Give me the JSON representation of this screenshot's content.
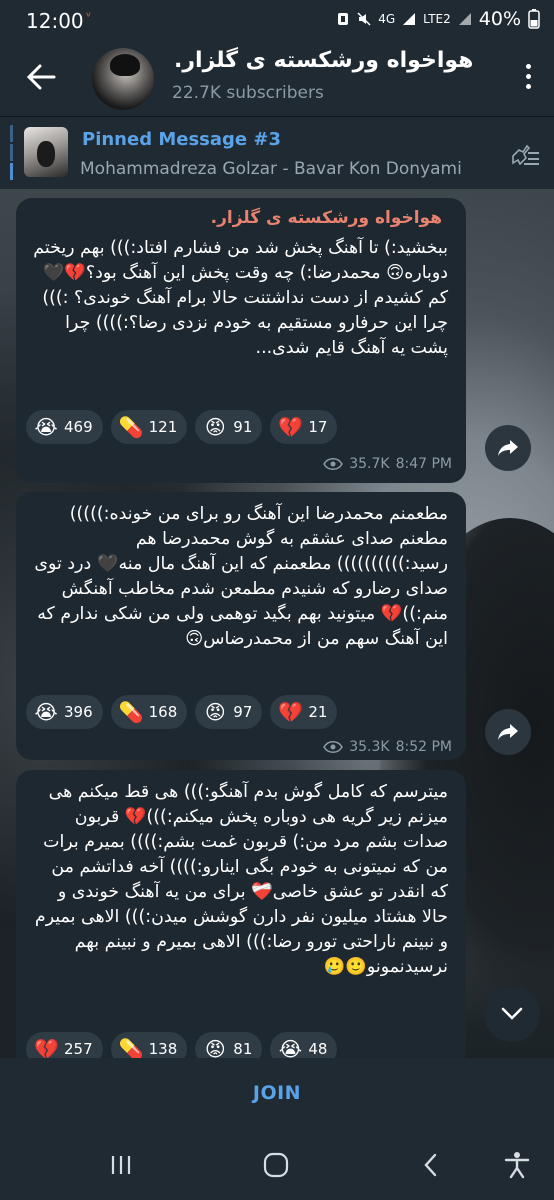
{
  "status": {
    "time": "12:00",
    "net": "4G",
    "lte": "LTE2",
    "battery": "40%"
  },
  "header": {
    "title": "هواخواه ورشکسته ی گلزار.",
    "subscribers": "22.7K subscribers"
  },
  "pinned": {
    "title": "Pinned Message #3",
    "text": "Mohammadreza Golzar - Bavar Kon Donyami"
  },
  "messages": [
    {
      "author": "هواخواه ورشکسته ی گلزار.",
      "text": "ببخشید:) تا آهنگ پخش شد من فشارم افتاد:))) بهم ریختم دوباره🙃 محمدرضا:) چه وقت پخش این آهنگ بود؟💔🖤 کم کشیدم از دست نداشتنت حالا برام آهنگ خوندی؟ :))) چرا این حرفارو مستقیم به خودم نزدی رضا؟:)))) چرا پشت یه آهنگ قایم شدی...",
      "reactions": [
        {
          "emoji": "😭",
          "count": "469"
        },
        {
          "emoji": "💊",
          "count": "121"
        },
        {
          "emoji": "😡",
          "count": "91"
        },
        {
          "emoji": "💔",
          "count": "17"
        }
      ],
      "views": "35.7K",
      "time": "8:47 PM"
    },
    {
      "author": "",
      "text": "مطعمنم محمدرضا این آهنگ رو برای من خونده:))))) مطعنم صدای عشقم به گوش محمدرضا هم رسید:)))))))))) مطعمنم که این آهنگ مال منه🖤 درد توی صدای رضارو که شنیدم مطمعن شدم مخاطب آهنگش منم:))💔 میتونید بهم بگید توهمی ولی من شکی ندارم که این آهنگ سهم من از محمدرضاس🙃",
      "reactions": [
        {
          "emoji": "😭",
          "count": "396"
        },
        {
          "emoji": "💊",
          "count": "168"
        },
        {
          "emoji": "😡",
          "count": "97"
        },
        {
          "emoji": "💔",
          "count": "21"
        }
      ],
      "views": "35.3K",
      "time": "8:52 PM"
    },
    {
      "author": "",
      "text": "میترسم که کامل گوش بدم آهنگو:))) هی قط میکنم هی میزنم زیر گریه هی دوباره پخش میکنم:)))💔 قربون صدات بشم مرد من:) قربون غمت بشم:)))) بمیرم برات من که نمیتونی به خودم بگی اینارو:)))) آخه فداتشم من که انقدر تو عشق خاصی❤️‍🩹 برای من یه آهنگ خوندی و حالا هشتاد میلیون نفر دارن گوشش میدن:))) الاهی بمیرم و نبینم ناراحتی تورو رضا:))) الاهی بمیرم و نبینم بهم نرسیدنمونو🙂🥲",
      "reactions": [
        {
          "emoji": "💔",
          "count": "257"
        },
        {
          "emoji": "💊",
          "count": "138"
        },
        {
          "emoji": "😡",
          "count": "81"
        },
        {
          "emoji": "😭",
          "count": "48"
        }
      ],
      "views": "",
      "time": ""
    }
  ],
  "join_label": "JOIN"
}
